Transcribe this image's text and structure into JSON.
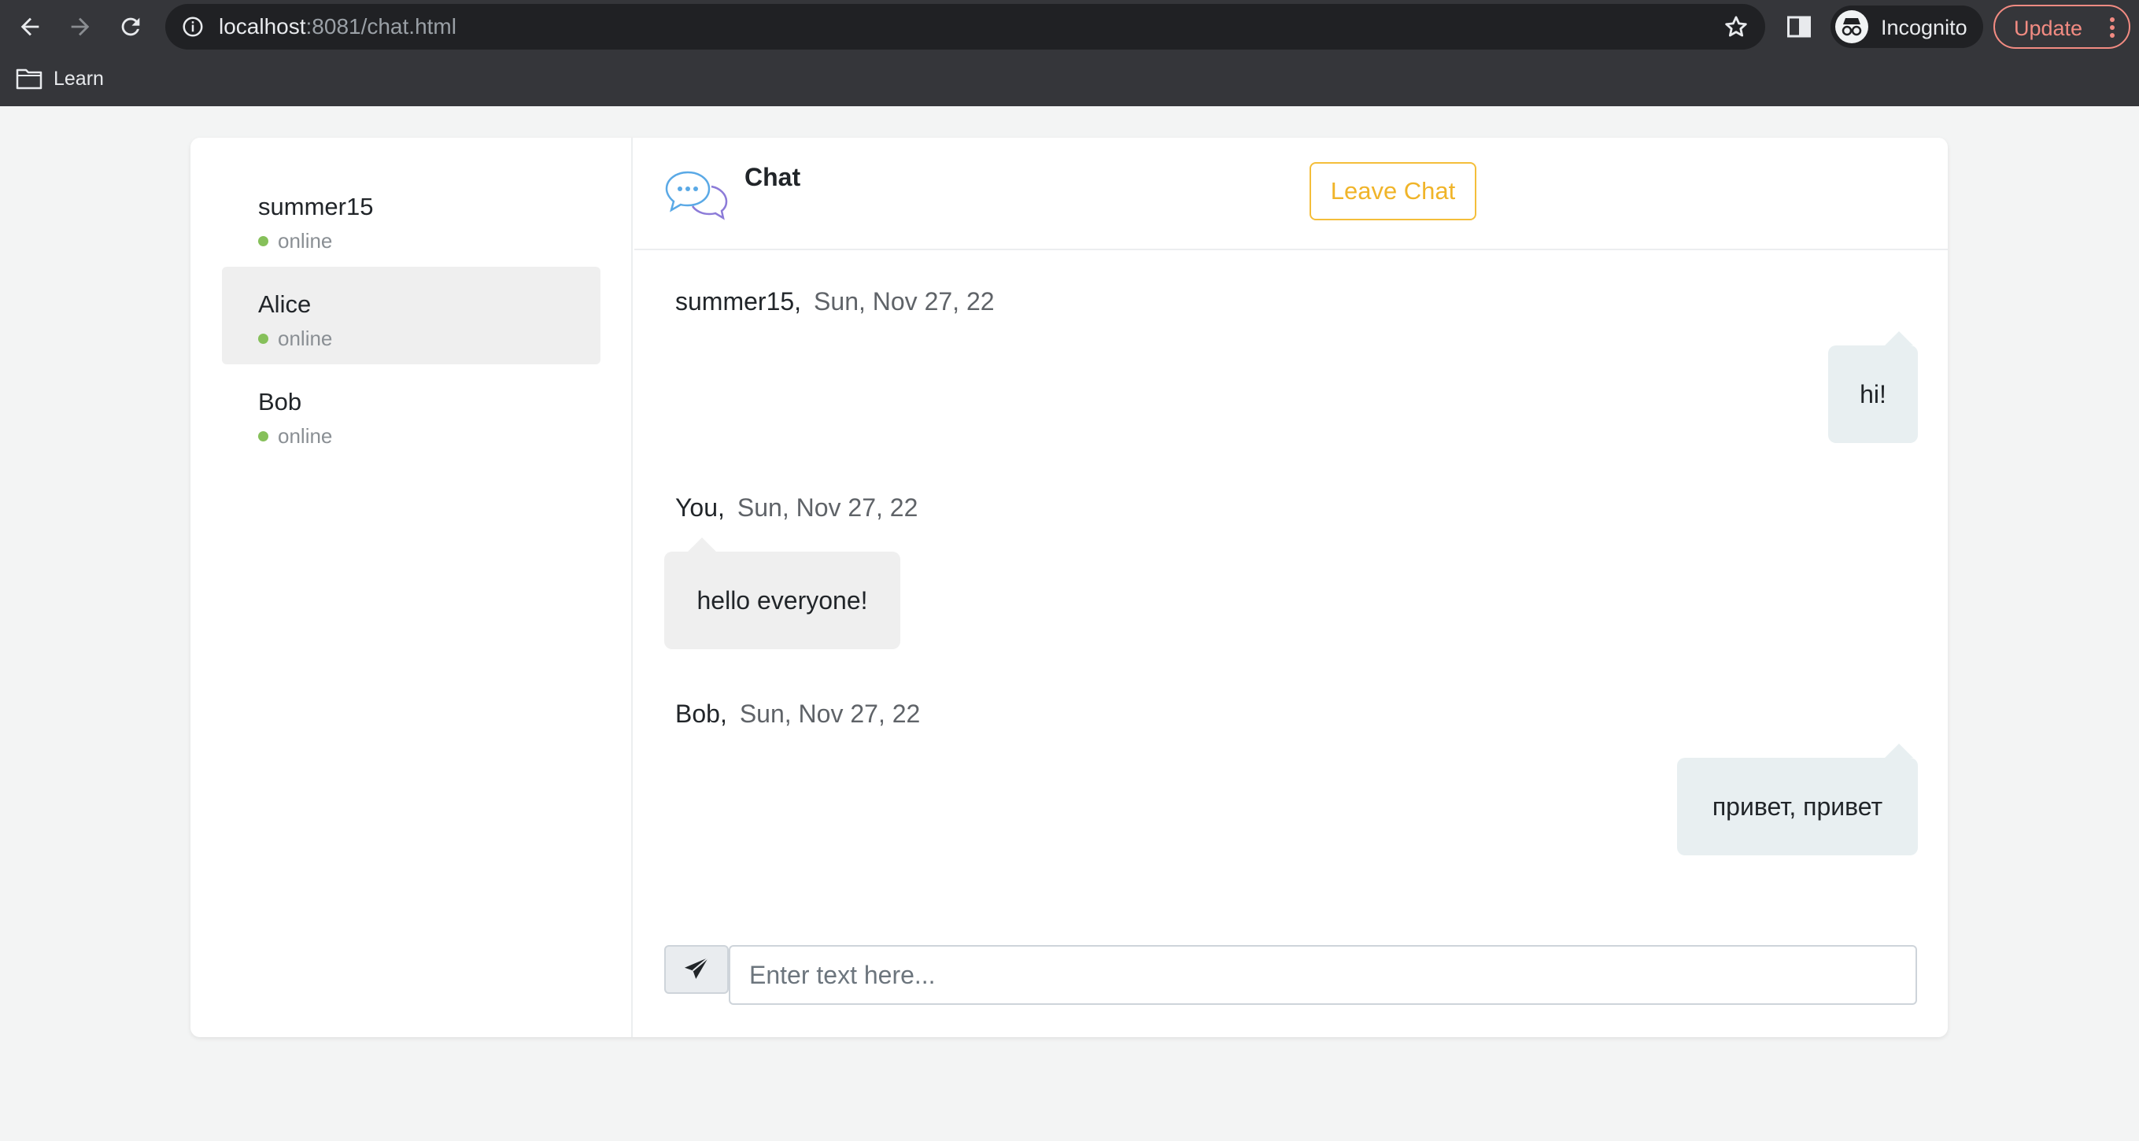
{
  "browser": {
    "url_host": "localhost",
    "url_rest": ":8081/chat.html",
    "profile_label": "Incognito",
    "update_label": "Update",
    "bookmarks": [
      {
        "label": "Learn"
      }
    ]
  },
  "sidebar": {
    "users": [
      {
        "name": "summer15",
        "status": "online",
        "active": false
      },
      {
        "name": "Alice",
        "status": "online",
        "active": true
      },
      {
        "name": "Bob",
        "status": "online",
        "active": false
      }
    ]
  },
  "chat": {
    "title": "Chat",
    "leave_label": "Leave Chat",
    "messages": [
      {
        "author": "summer15,",
        "date": "Sun, Nov 27, 22",
        "text": "hi!",
        "side": "right"
      },
      {
        "author": "You,",
        "date": "Sun, Nov 27, 22",
        "text": "hello everyone!",
        "side": "left"
      },
      {
        "author": "Bob,",
        "date": "Sun, Nov 27, 22",
        "text": "привет, привет",
        "side": "right"
      }
    ],
    "input_placeholder": "Enter text here..."
  },
  "colors": {
    "accent": "#f0b429",
    "online": "#86c05a",
    "bubble_right": "#e8eff1",
    "bubble_left": "#efefef"
  }
}
